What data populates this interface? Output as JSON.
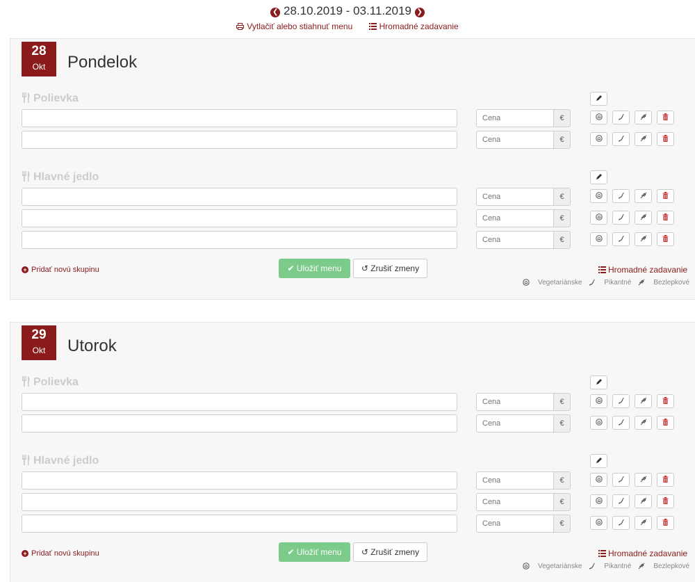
{
  "header": {
    "week_range": "28.10.2019 - 03.11.2019",
    "print_link": "Vytlačiť alebo stiahnuť menu",
    "bulk_link": "Hromadné zadavanie"
  },
  "days": [
    {
      "day_num": "28",
      "month": "Okt",
      "day_name": "Pondelok",
      "groups": [
        {
          "title": "Polievka",
          "rows": 2
        },
        {
          "title": "Hlavné jedlo",
          "rows": 3
        }
      ],
      "price_placeholder": "Cena",
      "currency": "€",
      "add_group": "Pridať novú skupinu",
      "save": "Uložiť menu",
      "cancel": "Zrušiť zmeny",
      "bulk": "Hromadné zadavanie",
      "legend": {
        "veg": "Vegetariánske",
        "spicy": "Pikantné",
        "gluten": "Bezlepkové"
      }
    },
    {
      "day_num": "29",
      "month": "Okt",
      "day_name": "Utorok",
      "groups": [
        {
          "title": "Polievka",
          "rows": 2
        },
        {
          "title": "Hlavné jedlo",
          "rows": 3
        }
      ],
      "price_placeholder": "Cena",
      "currency": "€",
      "add_group": "Pridať novú skupinu",
      "save": "Uložiť menu",
      "cancel": "Zrušiť zmeny",
      "bulk": "Hromadné zadavanie",
      "legend": {
        "veg": "Vegetariánske",
        "spicy": "Pikantné",
        "gluten": "Bezlepkové"
      }
    }
  ],
  "icons": {
    "prev": "chevron-left-icon",
    "next": "chevron-right-icon",
    "print": "print-icon",
    "list": "list-icon",
    "cutlery": "cutlery-icon",
    "edit": "pencil-icon",
    "veg": "vegetarian-icon",
    "spicy": "chili-icon",
    "gluten": "wheat-icon",
    "delete": "trash-icon"
  },
  "colors": {
    "accent": "#8b1a1a",
    "save": "#7dcb8a",
    "panel": "#f7f7f7",
    "group_title": "#cccccc"
  }
}
